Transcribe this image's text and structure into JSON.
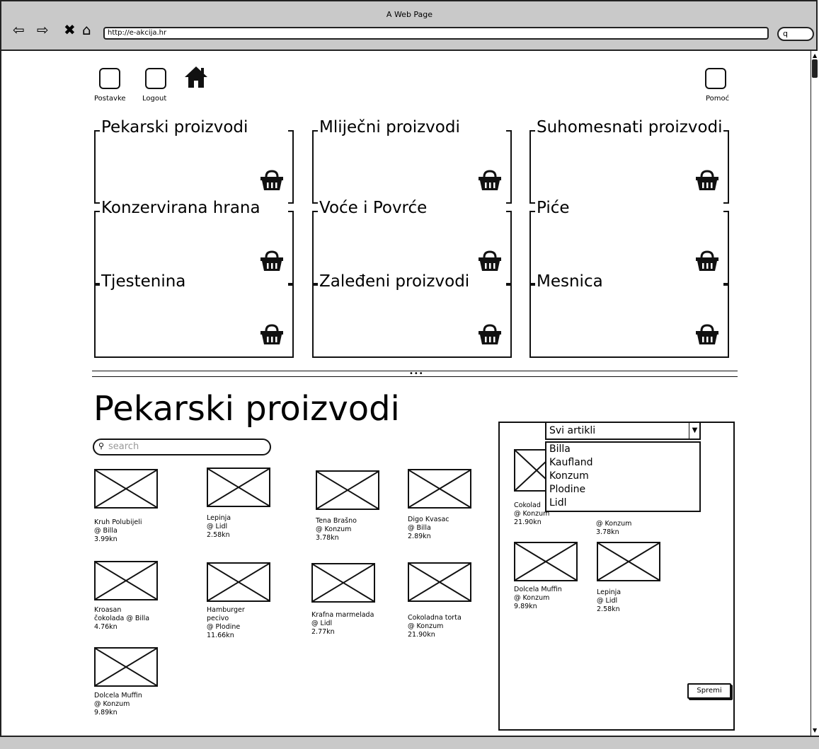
{
  "window": {
    "title": "A Web Page",
    "url": "http://e-akcija.hr",
    "search_glyph": "q"
  },
  "nav_icons": {
    "back": "back-arrow-icon",
    "forward": "forward-arrow-icon",
    "close": "close-icon",
    "home": "home-icon"
  },
  "topbar": {
    "settings_label": "Postavke",
    "logout_label": "Logout",
    "help_label": "Pomoć"
  },
  "categories": [
    "Pekarski proizvodi",
    "Mliječni proizvodi",
    "Suhomesnati proizvodi",
    "Konzervirana hrana",
    "Voće i Povrće",
    "Piće",
    "Tjestenina",
    "Zaleđeni proizvodi",
    "Mesnica"
  ],
  "section": {
    "title": "Pekarski proizvodi",
    "search_placeholder": "search"
  },
  "products": [
    {
      "text": "Kruh Polubijeli\n@ Billa\n3.99kn"
    },
    {
      "text": "Lepinja\n@ Lidl\n2.58kn"
    },
    {
      "text": "Tena Brašno\n@ Konzum\n3.78kn"
    },
    {
      "text": "Digo Kvasac\n@ Billa\n2.89kn"
    },
    {
      "text": "Kroasan\nčokolada @ Billa\n4.76kn"
    },
    {
      "text": "Hamburger\npecivo\n@ Plodine\n11.66kn"
    },
    {
      "text": "Krafna marmelada\n@ Lidl\n2.77kn"
    },
    {
      "text": "Cokoladna torta\n@ Konzum\n21.90kn"
    },
    {
      "text": "Dolcela Muffin\n@ Konzum\n9.89kn"
    }
  ],
  "cart": {
    "filter_selected": "Svi artikli",
    "filter_options": [
      "Billa",
      "Kaufland",
      "Konzum",
      "Plodine",
      "Lidl"
    ],
    "items": [
      {
        "text": "Cokolad\n@ Konzum\n21.90kn"
      },
      {
        "text": "\n@ Konzum\n3.78kn"
      },
      {
        "text": "Dolcela Muffin\n@ Konzum\n9.89kn"
      },
      {
        "text": "Lepinja\n@ Lidl\n2.58kn"
      }
    ],
    "save_label": "Spremi"
  }
}
